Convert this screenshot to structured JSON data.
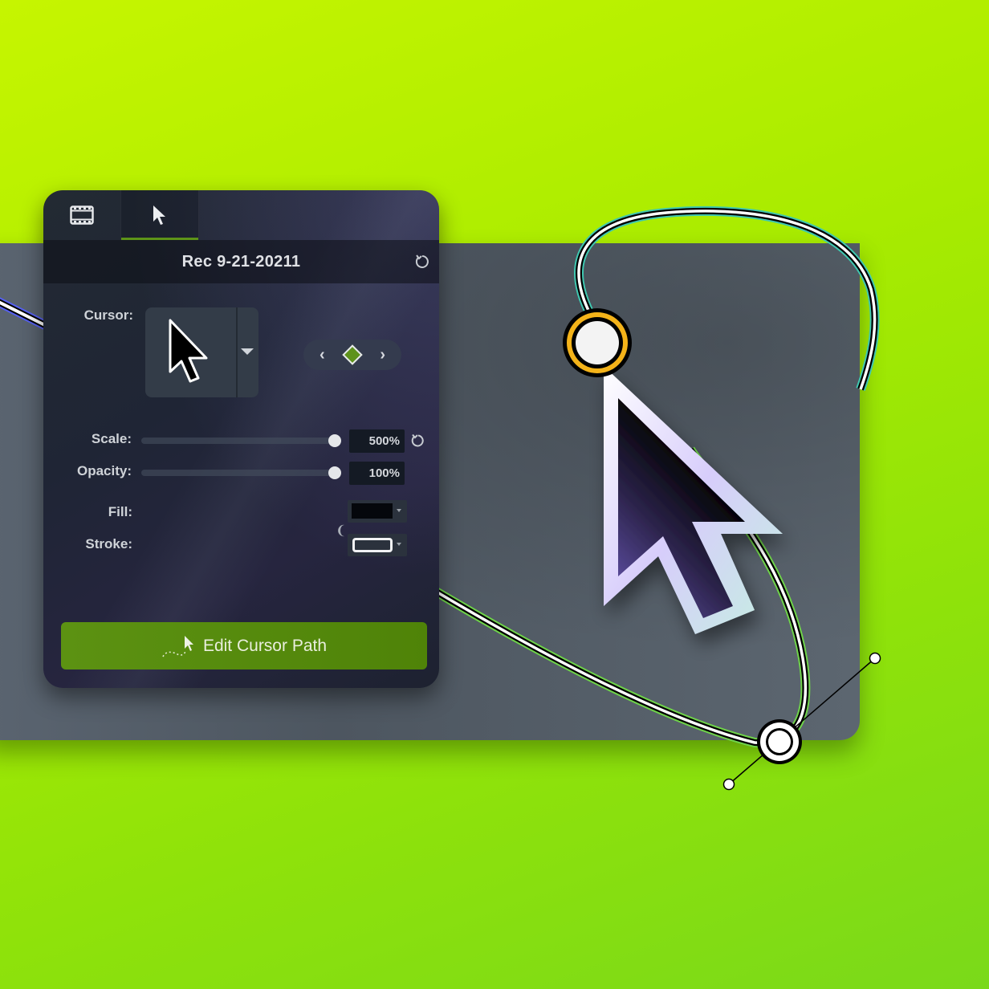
{
  "panel": {
    "tabs": [
      {
        "id": "visual-properties",
        "icon": "film-strip-icon",
        "active": false
      },
      {
        "id": "cursor-properties",
        "icon": "cursor-arrow-icon",
        "active": true
      }
    ],
    "title": "Rec 9-21-20211",
    "reset_icon": "reset-icon",
    "cursor_label": "Cursor:",
    "cursor_preview_icon": "cursor-arrow-icon",
    "keyframe_nav": {
      "prev": "‹",
      "next": "›",
      "keyframe_icon": "diamond-keyframe-icon"
    },
    "scale": {
      "label": "Scale:",
      "value": "500%",
      "fraction": 0.98
    },
    "opacity": {
      "label": "Opacity:",
      "value": "100%",
      "fraction": 0.98
    },
    "fill": {
      "label": "Fill:",
      "color": "#05070c"
    },
    "stroke": {
      "label": "Stroke:",
      "color": "#ffffff"
    },
    "link_icon": "link-icon",
    "edit_button": {
      "label": "Edit Cursor Path",
      "icon": "cursor-path-icon"
    }
  },
  "colors": {
    "accent_green": "#5c9212",
    "tab_indicator": "#5d9418",
    "keyframe_active": "#f4b319",
    "path_glow_blue": "#5560f0",
    "path_glow_teal": "#3fc7b0",
    "path_glow_green": "#6fd34a",
    "big_cursor_fill_dark": "#000000",
    "big_cursor_fill_purple": "#5b4aa0"
  }
}
